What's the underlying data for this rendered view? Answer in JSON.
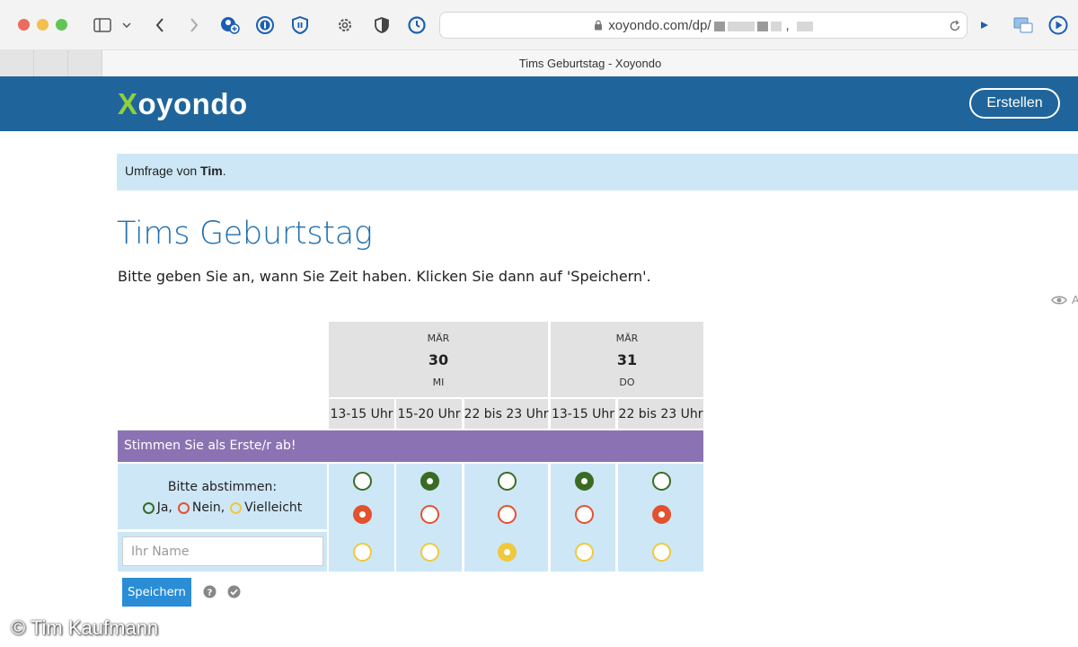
{
  "browser": {
    "url_visible": "xoyondo.com/dp/",
    "url_suffix": ",",
    "tab_title": "Tims Geburtstag - Xoyondo"
  },
  "site": {
    "logo_x": "X",
    "logo_rest": "oyondo",
    "create_button": "Erstellen",
    "colors": {
      "header": "#1f659b",
      "accent_green": "#8fd13b"
    }
  },
  "poll": {
    "owner_prefix": "Umfrage von ",
    "owner_name": "Tim",
    "owner_suffix": ".",
    "title": "Tims Geburtstag",
    "instructions": "Bitte geben Sie an, wann Sie Zeit haben. Klicken Sie dann auf 'Speichern'.",
    "eye_label": "A",
    "dates": [
      {
        "month": "MÄR",
        "day": "30",
        "weekday": "MI"
      },
      {
        "month": "MÄR",
        "day": "31",
        "weekday": "DO"
      }
    ],
    "slots": [
      "13-15 Uhr",
      "15-20 Uhr",
      "22 bis 23 Uhr",
      "13-15 Uhr",
      "22 bis 23 Uhr"
    ],
    "first_vote_banner": "Stimmen Sie als Erste/r ab!",
    "vote_label": "Bitte abstimmen:",
    "legend": [
      {
        "label": "Ja,",
        "color": "#3a6b22"
      },
      {
        "label": "Nein,",
        "color": "#e4512e"
      },
      {
        "label": "Vielleicht",
        "color": "#f0c83c"
      }
    ],
    "selections": [
      "no",
      "yes",
      "maybe",
      "yes",
      "no"
    ],
    "name_placeholder": "Ihr Name",
    "save_button": "Speichern"
  },
  "watermark": "© Tim Kaufmann"
}
